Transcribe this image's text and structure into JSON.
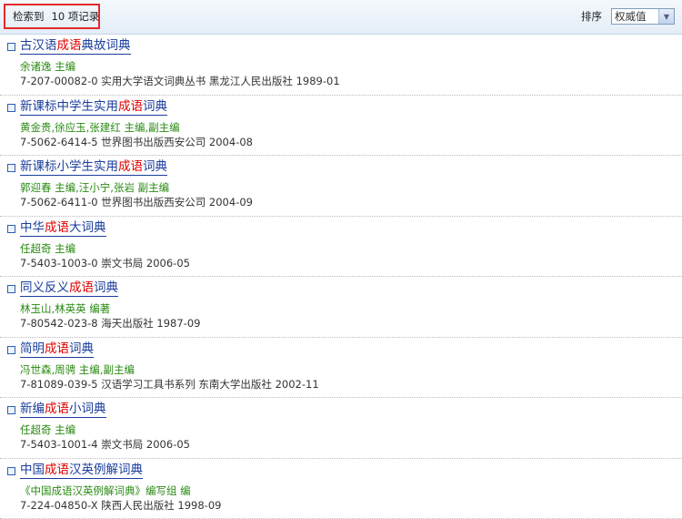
{
  "header": {
    "count_prefix": "检索到",
    "count_text": "10 项记录",
    "sort_label": "排序",
    "sort_selected": "权威值"
  },
  "results": [
    {
      "title_pre": "古汉语",
      "title_hl": "成语",
      "title_post": "典故词典",
      "authors": "余诸逸 主编",
      "pub": "7-207-00082-0 实用大学语文词典丛书 黑龙江人民出版社  1989-01"
    },
    {
      "title_pre": "新课标中学生实用",
      "title_hl": "成语",
      "title_post": "词典",
      "authors": "黄金贵,徐应玉,张建红  主编,副主编",
      "pub": "7-5062-6414-5 世界图书出版西安公司  2004-08"
    },
    {
      "title_pre": "新课标小学生实用",
      "title_hl": "成语",
      "title_post": "词典",
      "authors": "郭迎春   主编,汪小宁,张岩  副主编",
      "pub": "7-5062-6411-0 世界图书出版西安公司  2004-09"
    },
    {
      "title_pre": "中华",
      "title_hl": "成语",
      "title_post": "大词典",
      "authors": "任超奇  主编",
      "pub": "7-5403-1003-0 崇文书局  2006-05"
    },
    {
      "title_pre": "同义反义",
      "title_hl": "成语",
      "title_post": "词典",
      "authors": "林玉山,林英英  编著",
      "pub": "7-80542-023-8 海天出版社  1987-09"
    },
    {
      "title_pre": "简明",
      "title_hl": "成语",
      "title_post": "词典",
      "authors": "冯世森,周骋  主编,副主编",
      "pub": "7-81089-039-5 汉语学习工具书系列 东南大学出版社  2002-11"
    },
    {
      "title_pre": "新编",
      "title_hl": "成语",
      "title_post": "小词典",
      "authors": "任超奇  主编",
      "pub": "7-5403-1001-4 崇文书局  2006-05"
    },
    {
      "title_pre": "中国",
      "title_hl": "成语",
      "title_post": "汉英例解词典",
      "authors": "《中国成语汉英例解词典》编写组  编",
      "pub": "7-224-04850-X 陕西人民出版社  1998-09"
    }
  ]
}
